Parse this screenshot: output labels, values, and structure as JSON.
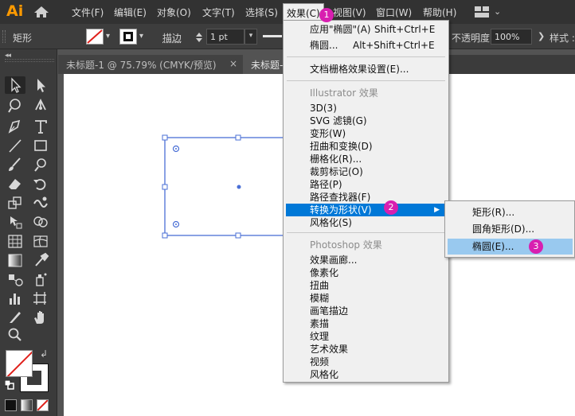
{
  "app": {
    "logo": "Ai"
  },
  "menubar": {
    "items": [
      "文件(F)",
      "编辑(E)",
      "对象(O)",
      "文字(T)",
      "选择(S)",
      "效果(C)",
      "视图(V)",
      "窗口(W)",
      "帮助(H)"
    ]
  },
  "controlbar": {
    "selection_type": "矩形",
    "stroke_label": "描边",
    "stroke_value": "1 pt",
    "opacity_label": "不透明度 :",
    "opacity_value": "100%",
    "style_label": "样式 :"
  },
  "tabs": [
    {
      "title": "未标题-1 @ 75.79% (CMYK/预览)",
      "close": "×"
    },
    {
      "title": "未标题-",
      "close": ""
    }
  ],
  "effect_menu": {
    "apply_last": {
      "label": "应用\"椭圆\"(A)",
      "shortcut": "Shift+Ctrl+E"
    },
    "last_effect": {
      "label": "椭圆...",
      "shortcut": "Alt+Shift+Ctrl+E"
    },
    "raster_settings": "文档栅格效果设置(E)...",
    "illustrator_header": "Illustrator 效果",
    "illustrator_items": [
      "3D(3)",
      "SVG 滤镜(G)",
      "变形(W)",
      "扭曲和变换(D)",
      "栅格化(R)...",
      "裁剪标记(O)",
      "路径(P)",
      "路径查找器(F)",
      "转换为形状(V)",
      "风格化(S)"
    ],
    "photoshop_header": "Photoshop 效果",
    "photoshop_items": [
      "效果画廊...",
      "像素化",
      "扭曲",
      "模糊",
      "画笔描边",
      "素描",
      "纹理",
      "艺术效果",
      "视频",
      "风格化"
    ]
  },
  "submenu": {
    "items": [
      "矩形(R)...",
      "圆角矩形(D)...",
      "椭圆(E)..."
    ]
  },
  "steps": [
    "1",
    "2",
    "3"
  ],
  "colors": {
    "menubar_bg": "#323232",
    "panel_bg": "#3b3b3b",
    "menu_bg": "#f0f0f0",
    "menu_highlight": "#0078d7",
    "submenu_highlight": "#99c9ef",
    "selection_blue": "#4a6fd6",
    "badge": "#d81fb0",
    "logo": "#ff9a00"
  },
  "icons": {
    "home": "home-icon",
    "workspace": "workspace-grid-icon",
    "tools": [
      "selection-tool-icon",
      "direct-selection-tool-icon",
      "magic-wand-icon",
      "lasso-icon",
      "pen-tool-icon",
      "curvature-tool-icon",
      "type-tool-icon",
      "line-tool-icon",
      "rectangle-tool-icon",
      "paintbrush-icon",
      "shaper-icon",
      "eraser-icon",
      "rotate-icon",
      "scale-icon",
      "warp-icon",
      "free-transform-icon",
      "shape-builder-icon",
      "perspective-grid-icon",
      "mesh-icon",
      "gradient-icon",
      "eyedropper-icon",
      "blend-icon",
      "symbol-sprayer-icon",
      "graph-icon",
      "artboard-icon",
      "slice-icon",
      "hand-icon",
      "zoom-icon"
    ]
  }
}
